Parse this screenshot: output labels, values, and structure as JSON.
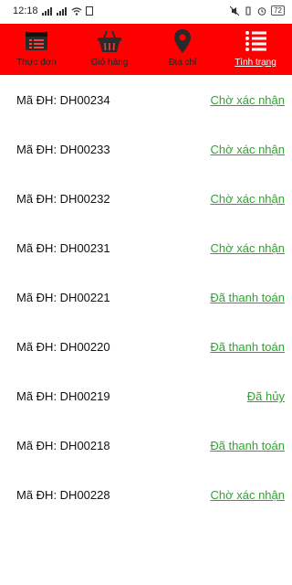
{
  "status_bar": {
    "time": "12:18",
    "battery": "72"
  },
  "nav": {
    "items": [
      {
        "label": "Thực đơn",
        "icon": "menu-card-icon"
      },
      {
        "label": "Giỏ hàng",
        "icon": "basket-icon"
      },
      {
        "label": "Địa chỉ",
        "icon": "location-pin-icon"
      },
      {
        "label": "Tình trạng",
        "icon": "status-list-icon"
      }
    ],
    "active_index": 3
  },
  "orders": [
    {
      "code_label": "Mã ĐH: DH00234",
      "status": "Chờ xác nhận"
    },
    {
      "code_label": "Mã ĐH: DH00233",
      "status": "Chờ xác nhận"
    },
    {
      "code_label": "Mã ĐH: DH00232",
      "status": "Chờ xác nhận"
    },
    {
      "code_label": "Mã ĐH: DH00231",
      "status": "Chờ xác nhận"
    },
    {
      "code_label": "Mã ĐH: DH00221",
      "status": "Đã thanh toán"
    },
    {
      "code_label": "Mã ĐH: DH00220",
      "status": "Đã thanh toán"
    },
    {
      "code_label": "Mã ĐH: DH00219",
      "status": "Đã hủy"
    },
    {
      "code_label": "Mã ĐH: DH00218",
      "status": "Đã thanh toán"
    },
    {
      "code_label": "Mã ĐH: DH00228",
      "status": "Chờ xác nhận"
    }
  ],
  "colors": {
    "header_bg": "#ff0000",
    "status_link": "#2aa82a"
  }
}
